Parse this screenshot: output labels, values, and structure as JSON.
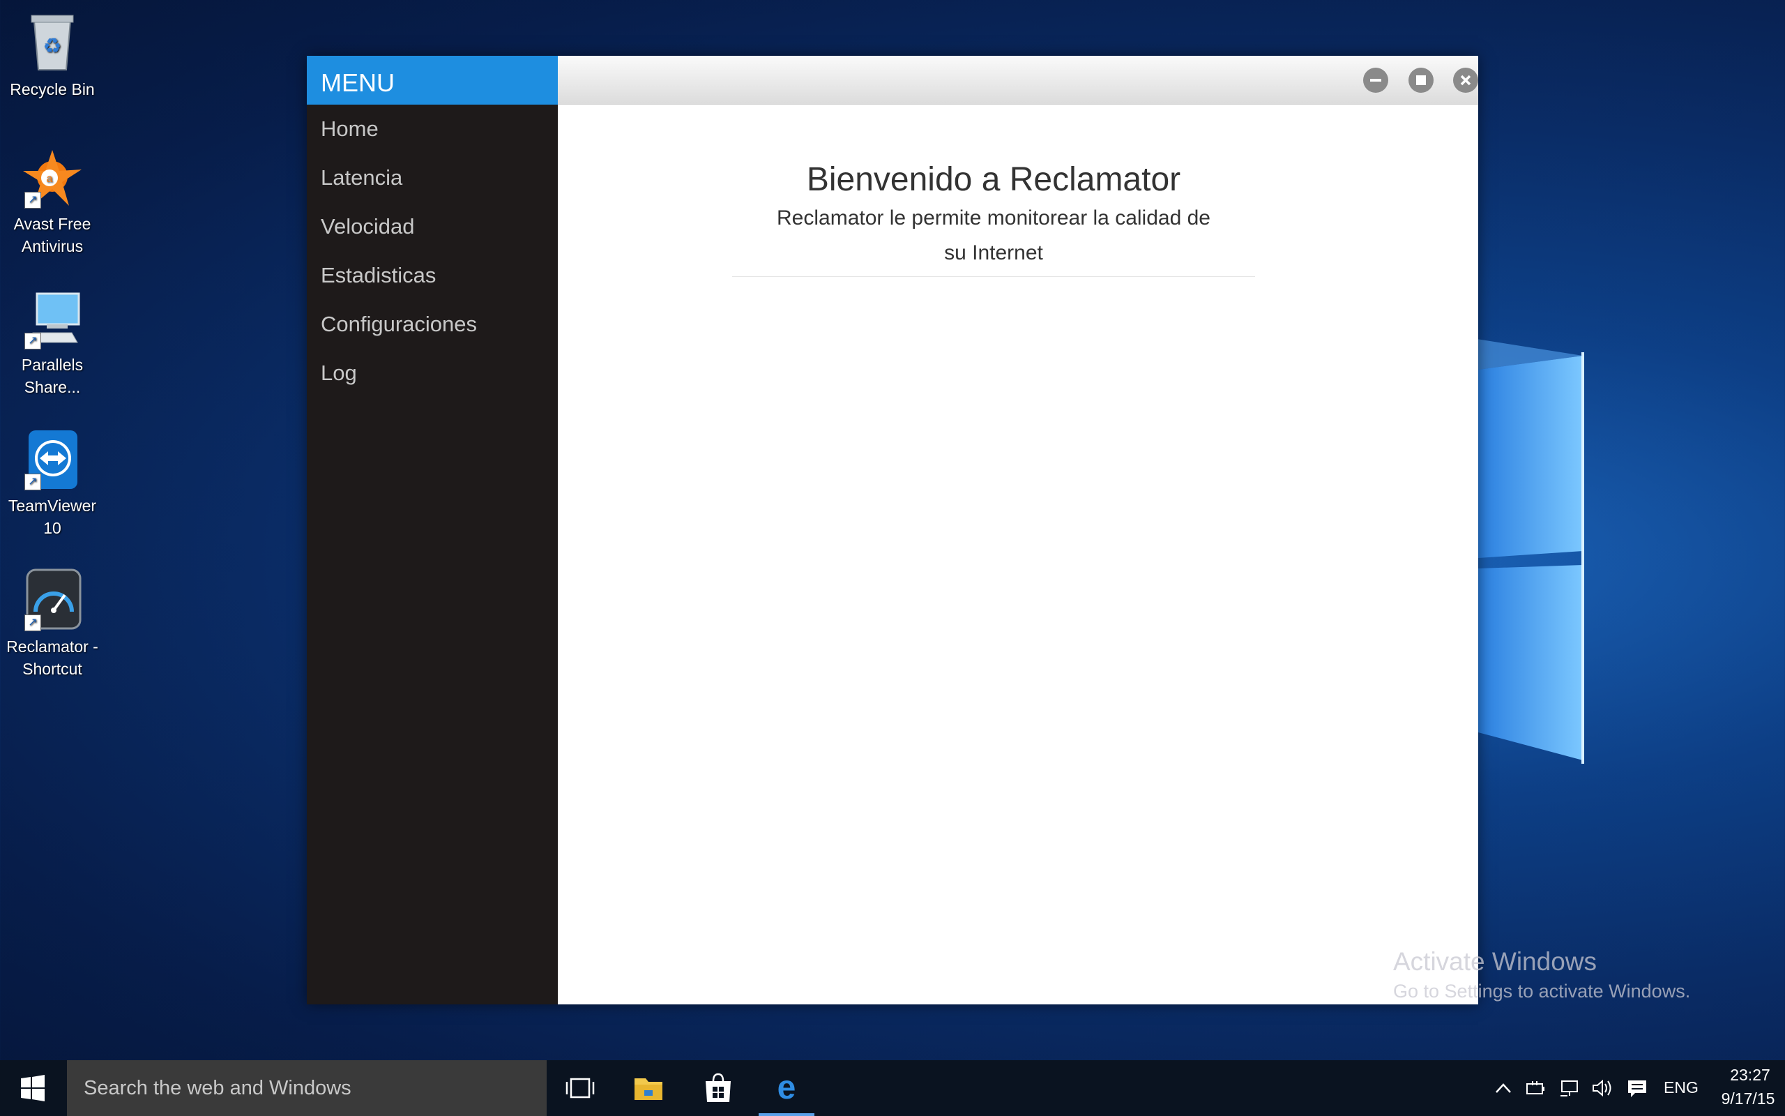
{
  "desktop": {
    "icons": [
      {
        "label": "Recycle Bin"
      },
      {
        "label": "Avast Free Antivirus"
      },
      {
        "label": "Parallels Share..."
      },
      {
        "label": "TeamViewer 10"
      },
      {
        "label": "Reclamator - Shortcut"
      }
    ]
  },
  "app": {
    "menu_header": "MENU",
    "nav": [
      "Home",
      "Latencia",
      "Velocidad",
      "Estadisticas",
      "Configuraciones",
      "Log"
    ],
    "title": "Bienvenido a Reclamator",
    "subtitle": "Reclamator le permite monitorear la calidad de su Internet",
    "window_buttons": {
      "minimize": "minimize-icon",
      "maximize": "maximize-icon",
      "close": "close-icon"
    }
  },
  "watermark": {
    "line1": "Activate Windows",
    "line2": "Go to Settings to activate Windows."
  },
  "taskbar": {
    "search_placeholder": "Search the web and Windows",
    "language": "ENG",
    "time": "23:27",
    "date": "9/17/15",
    "colors": {
      "accent": "#1e8ee0",
      "taskbar_bg": "#0a1320",
      "search_bg": "#3a3a3a"
    }
  }
}
